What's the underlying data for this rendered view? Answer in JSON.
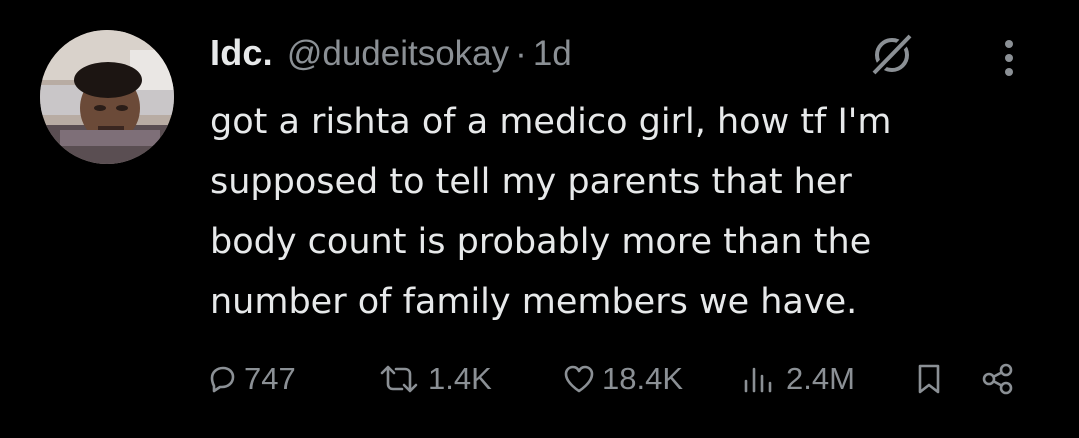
{
  "colors": {
    "background": "#000000",
    "text_primary": "#e7e9ea",
    "text_secondary": "#8b9095"
  },
  "tweet": {
    "display_name": "Idc.",
    "handle": "@dudeitsokay",
    "separator": "·",
    "time": "1d",
    "text": "got a rishta of a medico girl, how tf I'm\nsupposed to tell my parents that her\nbody count is probably more than the\nnumber of family members we have."
  },
  "icons": {
    "avatar": "profile-photo",
    "grok": "grok-slash-icon",
    "more": "more-vertical-icon"
  },
  "actions": {
    "replies": {
      "icon": "reply-icon",
      "count": "747"
    },
    "reposts": {
      "icon": "repost-icon",
      "count": "1.4K"
    },
    "likes": {
      "icon": "heart-icon",
      "count": "18.4K"
    },
    "views": {
      "icon": "analytics-icon",
      "count": "2.4M"
    },
    "bookmark": {
      "icon": "bookmark-icon"
    },
    "share": {
      "icon": "share-icon"
    }
  }
}
